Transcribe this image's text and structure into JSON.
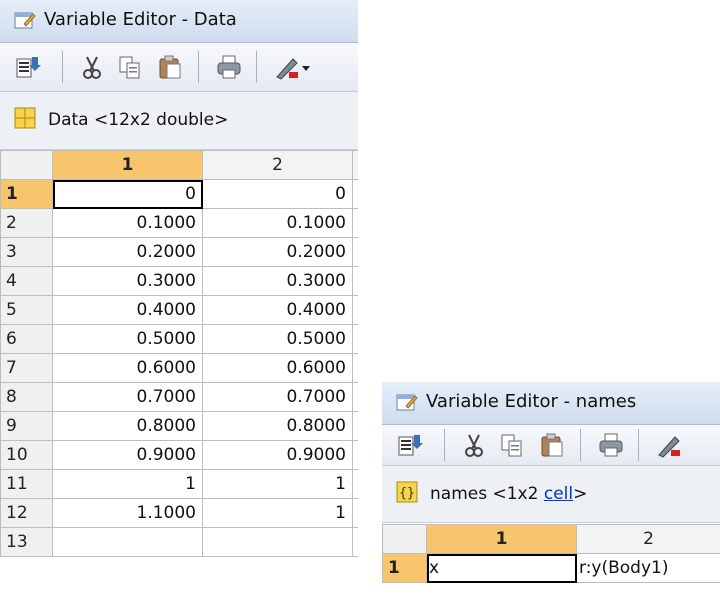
{
  "windows": [
    {
      "title": "Variable Editor - Data",
      "variable": {
        "name": "Data",
        "size": "12x2",
        "class": "double",
        "kind": "matrix"
      },
      "columns": [
        "1",
        "2"
      ],
      "rows": [
        {
          "index": "1",
          "cells": [
            "0",
            "0"
          ]
        },
        {
          "index": "2",
          "cells": [
            "0.1000",
            "0.1000"
          ]
        },
        {
          "index": "3",
          "cells": [
            "0.2000",
            "0.2000"
          ]
        },
        {
          "index": "4",
          "cells": [
            "0.3000",
            "0.3000"
          ]
        },
        {
          "index": "5",
          "cells": [
            "0.4000",
            "0.4000"
          ]
        },
        {
          "index": "6",
          "cells": [
            "0.5000",
            "0.5000"
          ]
        },
        {
          "index": "7",
          "cells": [
            "0.6000",
            "0.6000"
          ]
        },
        {
          "index": "8",
          "cells": [
            "0.7000",
            "0.7000"
          ]
        },
        {
          "index": "9",
          "cells": [
            "0.8000",
            "0.8000"
          ]
        },
        {
          "index": "10",
          "cells": [
            "0.9000",
            "0.9000"
          ]
        },
        {
          "index": "11",
          "cells": [
            "1",
            "1"
          ]
        },
        {
          "index": "12",
          "cells": [
            "1.1000",
            "1"
          ]
        },
        {
          "index": "13",
          "cells": [
            "",
            ""
          ]
        }
      ],
      "selected_row": "1",
      "selected_column": "1"
    },
    {
      "title": "Variable Editor - names",
      "variable": {
        "name": "names",
        "size": "1x2",
        "class": "cell",
        "kind": "cell"
      },
      "columns": [
        "1",
        "2"
      ],
      "rows": [
        {
          "index": "1",
          "cells": [
            "x",
            "r:y(Body1)"
          ]
        }
      ],
      "selected_row": "1",
      "selected_column": "1"
    }
  ],
  "toolbar_icons": [
    "import-data-icon",
    "cut-icon",
    "copy-icon",
    "paste-icon",
    "print-icon",
    "plot-icon",
    "dropdown-arrow-icon"
  ],
  "colors": {
    "selection_header": "#f6c56c",
    "title_gradient": "#cfdcee",
    "link": "#0033cc"
  }
}
